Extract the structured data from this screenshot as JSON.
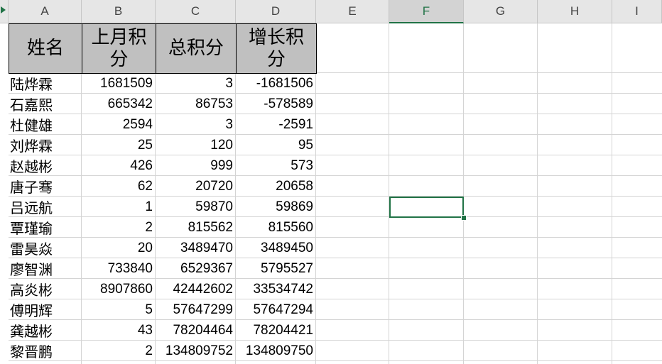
{
  "columns": [
    "A",
    "B",
    "C",
    "D",
    "E",
    "F",
    "G",
    "H",
    "I"
  ],
  "selected_cell": "F10",
  "table": {
    "headers": [
      "姓名",
      "上月积分",
      "总积分",
      "增长积分"
    ],
    "rows": [
      [
        "陆烨霖",
        "1681509",
        "3",
        "-1681506"
      ],
      [
        "石嘉熙",
        "665342",
        "86753",
        "-578589"
      ],
      [
        "杜健雄",
        "2594",
        "3",
        "-2591"
      ],
      [
        "刘烨霖",
        "25",
        "120",
        "95"
      ],
      [
        "赵越彬",
        "426",
        "999",
        "573"
      ],
      [
        "唐子骞",
        "62",
        "20720",
        "20658"
      ],
      [
        "吕远航",
        "1",
        "59870",
        "59869"
      ],
      [
        "覃瑾瑜",
        "2",
        "815562",
        "815560"
      ],
      [
        "雷昊焱",
        "20",
        "3489470",
        "3489450"
      ],
      [
        "廖智渊",
        "733840",
        "6529367",
        "5795527"
      ],
      [
        "高炎彬",
        "8907860",
        "42442602",
        "33534742"
      ],
      [
        "傅明辉",
        "5",
        "57647299",
        "57647294"
      ],
      [
        "龚越彬",
        "43",
        "78204464",
        "78204421"
      ],
      [
        "黎晋鹏",
        "2",
        "134809752",
        "134809750"
      ]
    ]
  },
  "colors": {
    "accent": "#217346",
    "header_fill": "#c0c0c0",
    "gridline": "#d4d4d4"
  }
}
